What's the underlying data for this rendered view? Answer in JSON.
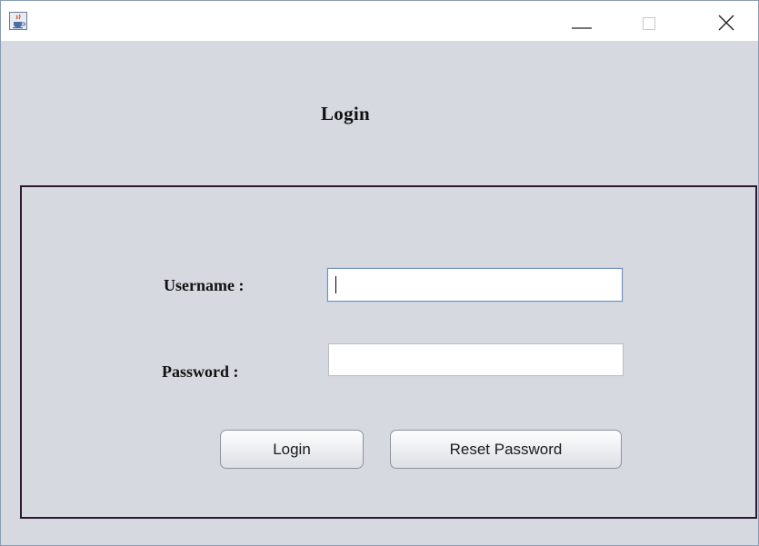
{
  "window": {
    "app_icon": "java-cup-icon",
    "controls": {
      "minimize_icon": "minimize-icon",
      "maximize_icon": "maximize-icon",
      "close_icon": "close-icon"
    }
  },
  "heading": "Login",
  "form": {
    "username": {
      "label": "Username :",
      "value": "",
      "focused": true
    },
    "password": {
      "label": "Password :",
      "value": ""
    },
    "buttons": {
      "login_label": "Login",
      "reset_label": "Reset Password"
    }
  },
  "colors": {
    "background": "#d6d9e0",
    "panel_border": "#2e1733",
    "focus_border": "#6f8fb8"
  }
}
